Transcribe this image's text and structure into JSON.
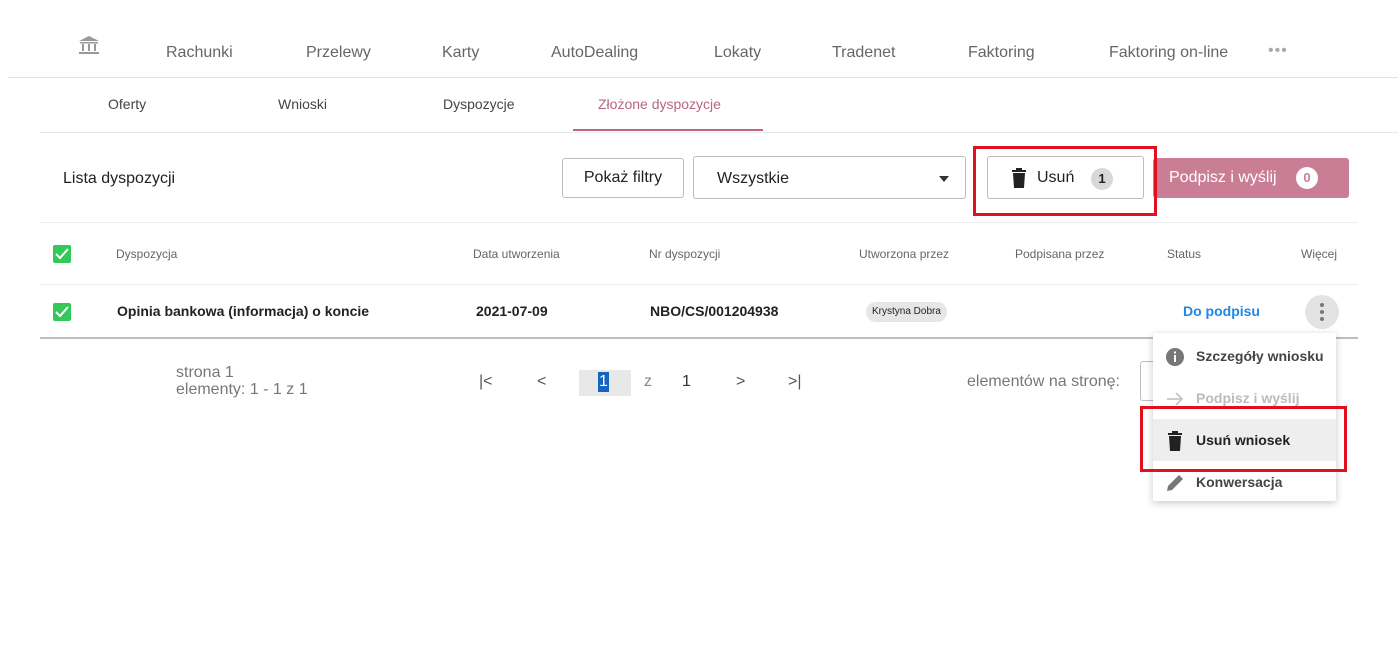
{
  "topnav": {
    "items": [
      "Rachunki",
      "Przelewy",
      "Karty",
      "AutoDealing",
      "Lokaty",
      "Tradenet",
      "Faktoring",
      "Faktoring on-line"
    ],
    "more": "•••"
  },
  "subtabs": [
    "Oferty",
    "Wnioski",
    "Dyspozycje",
    "Złożone dyspozycje"
  ],
  "toolbar": {
    "title": "Lista dyspozycji",
    "filters_label": "Pokaż filtry",
    "select_value": "Wszystkie",
    "delete_label": "Usuń",
    "delete_count": "1",
    "sign_label": "Podpisz i wyślij",
    "sign_count": "0"
  },
  "table": {
    "headers": [
      "Dyspozycja",
      "Data utworzenia",
      "Nr dyspozycji",
      "Utworzona przez",
      "Podpisana przez",
      "Status",
      "Więcej"
    ],
    "rows": [
      {
        "name": "Opinia bankowa (informacja) o koncie",
        "date": "2021-07-09",
        "number": "NBO/CS/001204938",
        "created_by": "Krystyna Dobra",
        "signed_by": "",
        "status": "Do podpisu"
      }
    ]
  },
  "pagination": {
    "page_label": "strona 1",
    "items_label": "elementy: 1 - 1 z 1",
    "current": "1",
    "of": "z",
    "total": "1",
    "per_page_label": "elementów na stronę:",
    "first": "|<",
    "prev": "<",
    "next": ">",
    "last": ">|"
  },
  "menu": {
    "items": [
      "Szczegóły wniosku",
      "Podpisz i wyślij",
      "Usuń wniosek",
      "Konwersacja"
    ]
  },
  "colors": {
    "accent": "#b9657f",
    "sign_button": "#c97e96",
    "status_link": "#1e88e5",
    "checkbox": "#34c759",
    "highlight": "#e0101f"
  }
}
